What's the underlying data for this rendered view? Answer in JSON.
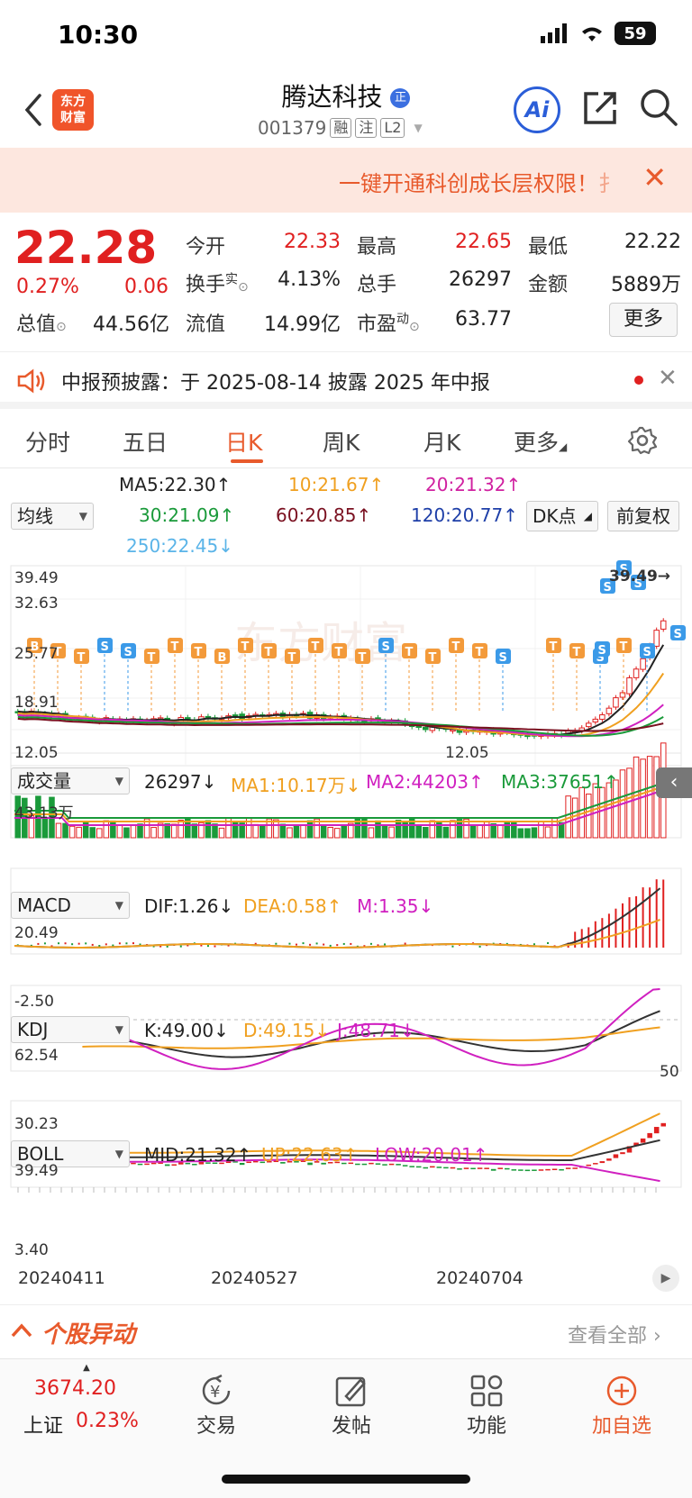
{
  "status": {
    "time": "10:30",
    "battery": "59"
  },
  "header": {
    "logo_line1": "东方",
    "logo_line2": "财富",
    "stock_name": "腾达科技",
    "name_badge": "正",
    "stock_code": "001379",
    "tags": [
      "融",
      "注",
      "L2"
    ],
    "ai_label": "Ai"
  },
  "banner": {
    "text": "一键开通科创成长层权限！",
    "tail": "扌"
  },
  "quote": {
    "price": "22.28",
    "change_pct": "0.27%",
    "change_abs": "0.06",
    "open_label": "今开",
    "open": "22.33",
    "high_label": "最高",
    "high": "22.65",
    "low_label": "最低",
    "low": "22.22",
    "turnover_label": "换手",
    "turnover_sup": "实",
    "turnover": "4.13%",
    "volume_label": "总手",
    "volume": "26297",
    "amount_label": "金额",
    "amount": "5889万",
    "mktcap_label": "总值",
    "mktcap": "44.56亿",
    "float_label": "流值",
    "float": "14.99亿",
    "pe_label": "市盈",
    "pe_sup": "动",
    "pe": "63.77",
    "more": "更多"
  },
  "notice": {
    "text": "中报预披露：于 2025-08-14 披露 2025 年中报"
  },
  "tabs": [
    "分时",
    "五日",
    "日K",
    "周K",
    "月K",
    "更多"
  ],
  "active_tab": "日K",
  "ma_legend": {
    "selector": "均线",
    "ma5": "MA5:22.30↑",
    "ma10": "10:21.67↑",
    "ma20": "20:21.32↑",
    "ma30": "30:21.09↑",
    "ma60": "60:20.85↑",
    "ma120": "120:20.77↑",
    "ma250": "250:22.45↓",
    "dk_button": "DK点",
    "adjust_button": "前复权"
  },
  "kline": {
    "y_top": "39.49",
    "y_2": "32.63",
    "y_3": "25.77",
    "y_4": "18.91",
    "y_bottom": "12.05",
    "max_marker": "39.49→",
    "min_marker": "12.05"
  },
  "volume": {
    "selector": "成交量",
    "value": "26297↓",
    "ma1": "MA1:10.17万↓",
    "ma2": "MA2:44203↑",
    "ma3": "MA3:37651↑",
    "y_top": "43.13万"
  },
  "macd": {
    "selector": "MACD",
    "dif": "DIF:1.26↓",
    "dea": "DEA:0.58↑",
    "m": "M:1.35↓",
    "y_top": "20.49",
    "y_bottom": "-2.50"
  },
  "kdj": {
    "selector": "KDJ",
    "k": "K:49.00↓",
    "d": "D:49.15↓",
    "j": "J:48.71↓",
    "y_top": "62.54",
    "y_bottom": "30.23",
    "mid_label": "50"
  },
  "boll": {
    "selector": "BOLL",
    "mid": "MID:21.32↑",
    "up": "UP:22.63↑",
    "low": "LOW:20.01↑",
    "y_top": "39.49",
    "y_bottom": "3.40"
  },
  "dates": [
    "20240411",
    "20240527",
    "20240704"
  ],
  "stock_news": {
    "title": "个股异动",
    "view_all": "查看全部"
  },
  "bottom_nav": {
    "index_value": "3674.20",
    "index_name": "上证",
    "index_change": "0.23%",
    "items": [
      "交易",
      "发帖",
      "功能",
      "加自选"
    ]
  },
  "colors": {
    "accent": "#e85a2c",
    "up": "#e02020",
    "down": "#1a9a3a",
    "ma5": "#222222",
    "ma10": "#f0a020",
    "ma20": "#d020c0"
  }
}
